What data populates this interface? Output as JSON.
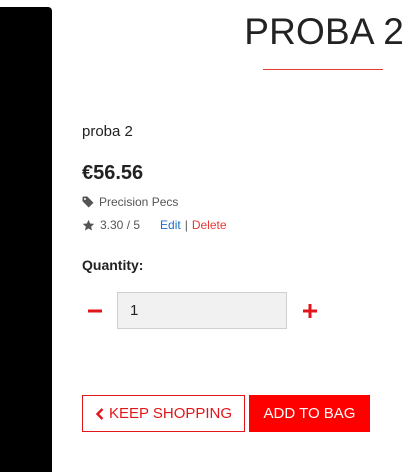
{
  "product": {
    "title": "PROBA 2",
    "description": "proba 2",
    "price": "€56.56",
    "category": "Precision Pecs",
    "rating": "3.30 / 5",
    "edit_label": "Edit",
    "separator": "|",
    "delete_label": "Delete"
  },
  "quantity": {
    "label": "Quantity:",
    "value": "1",
    "decrement_icon": "minus-icon",
    "increment_icon": "plus-icon"
  },
  "actions": {
    "keep_shopping_label": "KEEP SHOPPING",
    "add_to_bag_label": "ADD TO BAG"
  },
  "icons": {
    "category": "tag-icon",
    "rating": "star-icon",
    "back": "chevron-left-icon"
  },
  "colors": {
    "accent": "#e0161b",
    "primary_button": "#ff0000",
    "link": "#1a73c9",
    "side_panel": "#000000"
  }
}
